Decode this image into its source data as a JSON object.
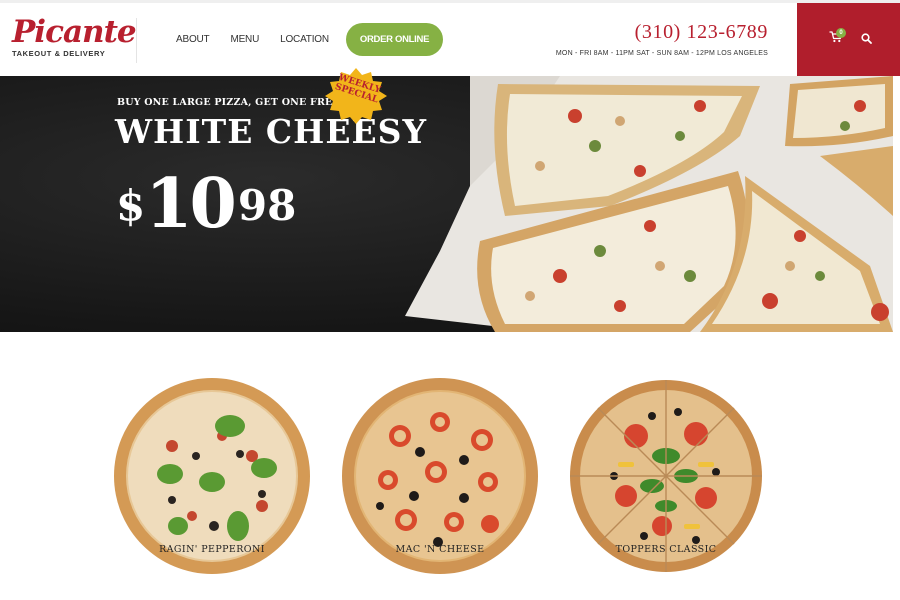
{
  "brand": {
    "name": "Picante",
    "tagline": "TAKEOUT & DELIVERY",
    "accent": "#b8202f",
    "green": "#86b144"
  },
  "nav": {
    "items": [
      {
        "label": "ABOUT"
      },
      {
        "label": "MENU"
      },
      {
        "label": "LOCATION"
      }
    ],
    "order_label": "ORDER ONLINE"
  },
  "contact": {
    "phone": "(310) 123-6789",
    "hours": [
      "MON - FRI 8AM - 11PM SAT - SUN 8AM - 12PM LOS ANGELES"
    ]
  },
  "header_actions": {
    "cart_icon": "cart-icon",
    "cart_count": "0",
    "search_icon": "search-icon"
  },
  "hero": {
    "kicker": "BUY ONE LARGE PIZZA, GET ONE FREE",
    "title": "WHITE CHEESY",
    "price_currency": "$",
    "price_whole": "10",
    "price_cents": "98",
    "seal_line1": "WEEKLY",
    "seal_line2": "SPECIAL"
  },
  "products": [
    {
      "name": "RAGIN' PEPPERONI"
    },
    {
      "name": "MAC 'N CHEESE"
    },
    {
      "name": "TOPPERS CLASSIC"
    }
  ]
}
